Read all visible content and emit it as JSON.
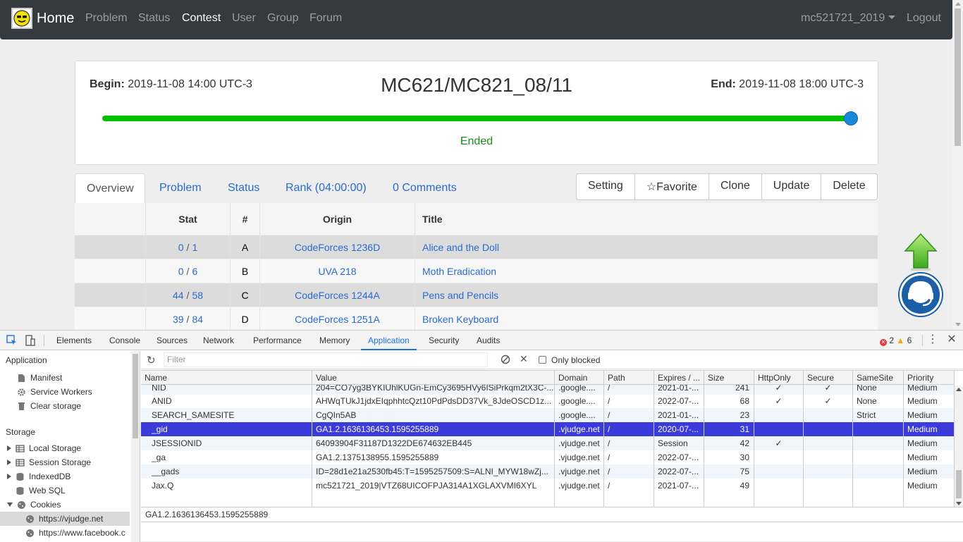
{
  "navbar": {
    "brand": "Home",
    "links": [
      "Problem",
      "Status",
      "Contest",
      "User",
      "Group",
      "Forum"
    ],
    "active": "Contest",
    "user": "mc521721_2019",
    "logout": "Logout"
  },
  "contest": {
    "begin_label": "Begin:",
    "begin_value": "2019-11-08 14:00 UTC-3",
    "end_label": "End:",
    "end_value": "2019-11-08 18:00 UTC-3",
    "title": "MC621/MC821_08/11",
    "progress_percent": 100,
    "status": "Ended",
    "colors": {
      "progress": "#00c000",
      "knob": "#1a86d8",
      "ended": "#1e8a1e"
    }
  },
  "tabs": [
    "Overview",
    "Problem",
    "Status",
    "Rank (04:00:00)",
    "0 Comments"
  ],
  "actions": [
    "Setting",
    "Favorite",
    "Clone",
    "Update",
    "Delete"
  ],
  "problems": {
    "headers": [
      "Stat",
      "#",
      "Origin",
      "Title"
    ],
    "rows": [
      {
        "solved": "0",
        "tried": "1",
        "num": "A",
        "origin": "CodeForces 1236D",
        "title": "Alice and the Doll"
      },
      {
        "solved": "0",
        "tried": "6",
        "num": "B",
        "origin": "UVA 218",
        "title": "Moth Eradication"
      },
      {
        "solved": "44",
        "tried": "58",
        "num": "C",
        "origin": "CodeForces 1244A",
        "title": "Pens and Pencils"
      },
      {
        "solved": "39",
        "tried": "84",
        "num": "D",
        "origin": "CodeForces 1251A",
        "title": "Broken Keyboard"
      }
    ]
  },
  "devtools": {
    "tabs": [
      "Elements",
      "Console",
      "Sources",
      "Network",
      "Performance",
      "Memory",
      "Application",
      "Security",
      "Audits"
    ],
    "active_tab": "Application",
    "errors": "2",
    "warnings": "6",
    "sidebar": {
      "application_heading": "Application",
      "application_items": [
        "Manifest",
        "Service Workers",
        "Clear storage"
      ],
      "storage_heading": "Storage",
      "storage_items": [
        "Local Storage",
        "Session Storage",
        "IndexedDB",
        "Web SQL",
        "Cookies"
      ],
      "cookie_sites": [
        "https://vjudge.net",
        "https://www.facebook.c"
      ]
    },
    "filter_placeholder": "Filter",
    "only_blocked": "Only blocked",
    "cookie_columns": [
      "Name",
      "Value",
      "Domain",
      "Path",
      "Expires / ...",
      "Size",
      "HttpOnly",
      "Secure",
      "SameSite",
      "Priority"
    ],
    "cookies": [
      {
        "name": "NID",
        "value": "204=CO7yg3BYKIUhlKUGn-EmCy3695HVy6ISiPrkqm2tX3C-...",
        "domain": ".google....",
        "path": "/",
        "expires": "2021-01-...",
        "size": "241",
        "httponly": "✓",
        "secure": "✓",
        "samesite": "None",
        "priority": "Medium"
      },
      {
        "name": "ANID",
        "value": "AHWqTUkJ1jdxEIqphhtcQzt10PdPdsDD37Vk_8JdeOSCD1z...",
        "domain": ".google....",
        "path": "/",
        "expires": "2022-07-...",
        "size": "68",
        "httponly": "✓",
        "secure": "✓",
        "samesite": "None",
        "priority": "Medium"
      },
      {
        "name": "SEARCH_SAMESITE",
        "value": "CgQIn5AB",
        "domain": ".google....",
        "path": "/",
        "expires": "2021-01-...",
        "size": "23",
        "httponly": "",
        "secure": "",
        "samesite": "Strict",
        "priority": "Medium"
      },
      {
        "name": "_gid",
        "value": "GA1.2.1636136453.1595255889",
        "domain": ".vjudge.net",
        "path": "/",
        "expires": "2020-07-...",
        "size": "31",
        "httponly": "",
        "secure": "",
        "samesite": "",
        "priority": "Medium"
      },
      {
        "name": "JSESSIONID",
        "value": "64093904F31187D1322DE674632EB445",
        "domain": ".vjudge.net",
        "path": "/",
        "expires": "Session",
        "size": "42",
        "httponly": "✓",
        "secure": "",
        "samesite": "",
        "priority": "Medium"
      },
      {
        "name": "_ga",
        "value": "GA1.2.1375138955.1595255889",
        "domain": ".vjudge.net",
        "path": "/",
        "expires": "2022-07-...",
        "size": "30",
        "httponly": "",
        "secure": "",
        "samesite": "",
        "priority": "Medium"
      },
      {
        "name": "__gads",
        "value": "ID=28d1e21a2530fb45:T=1595257509:S=ALNI_MYW18wZj...",
        "domain": ".vjudge.net",
        "path": "/",
        "expires": "2022-07-...",
        "size": "75",
        "httponly": "",
        "secure": "",
        "samesite": "",
        "priority": "Medium"
      },
      {
        "name": "Jax.Q",
        "value": "mc521721_2019|VTZ68UICOFPJA314A1XGLAXVMI6XYL",
        "domain": ".vjudge.net",
        "path": "/",
        "expires": "2021-07-...",
        "size": "49",
        "httponly": "",
        "secure": "",
        "samesite": "",
        "priority": "Medium"
      }
    ],
    "selected_row": 3,
    "preview_value": "GA1.2.1636136453.1595255889"
  }
}
